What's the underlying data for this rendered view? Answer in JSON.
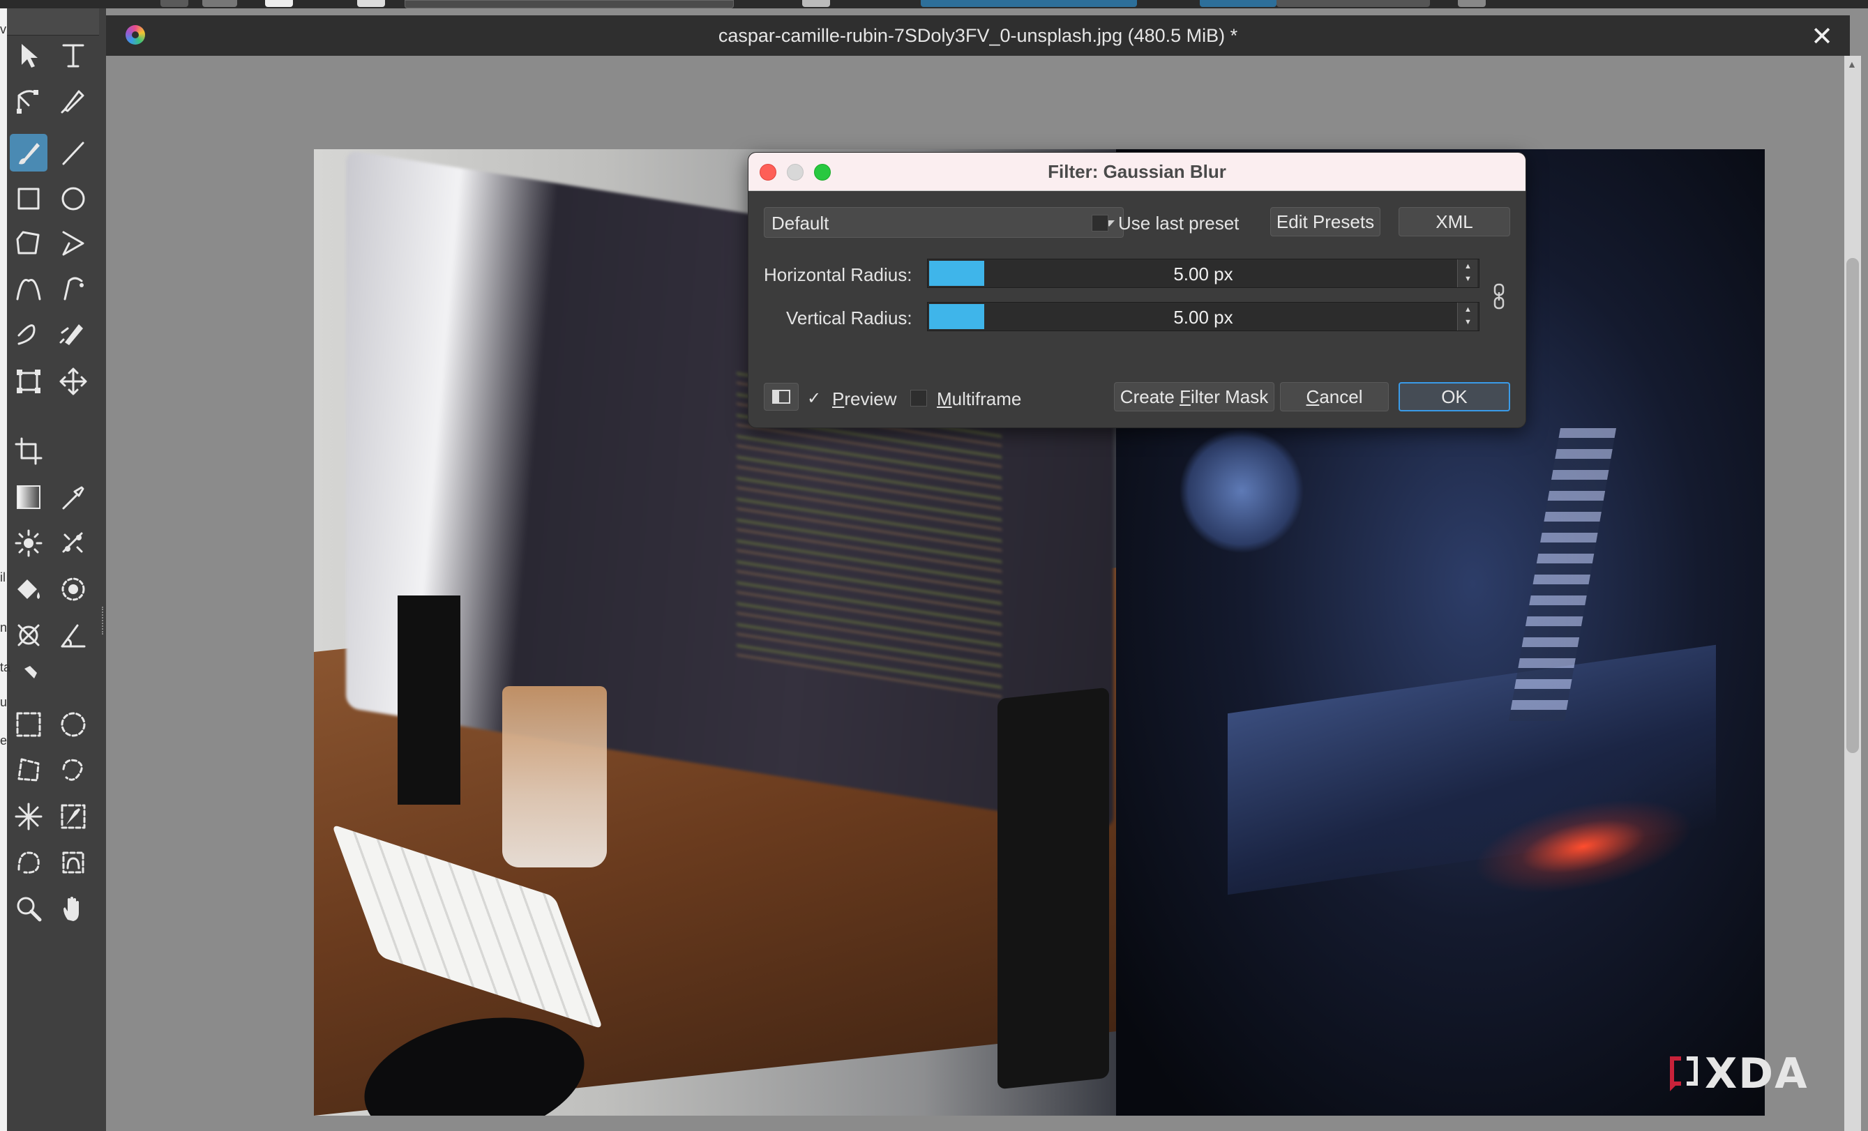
{
  "window": {
    "title": "caspar-camille-rubin-7SDoly3FV_0-unsplash.jpg (480.5 MiB) *",
    "close_glyph": "✕"
  },
  "toolbox": {
    "tools": [
      "select-shapes",
      "text",
      "edit-shapes",
      "calligraphy",
      "freehand-brush",
      "line",
      "rectangle",
      "ellipse",
      "polygon",
      "polyline",
      "bezier-curve",
      "freehand-path",
      "dynamic-brush",
      "multibrush",
      "transform",
      "move",
      "crop",
      "gradient",
      "color-sampler",
      "colorize-mask",
      "smart-patch",
      "fill",
      "enclose-and-fill",
      "assistant",
      "measure",
      "reference-images",
      "rectangular-selection",
      "elliptical-selection",
      "polygonal-selection",
      "freehand-selection",
      "contiguous-selection",
      "similar-color-selection",
      "bezier-selection",
      "magnetic-selection",
      "zoom",
      "pan"
    ],
    "active_tool": "freehand-brush",
    "edge_letters": [
      "v",
      "il",
      "n",
      "ta",
      "u",
      "e"
    ]
  },
  "dialog": {
    "title": "Filter: Gaussian Blur",
    "preset": "Default",
    "use_last_preset_label": "Use last preset",
    "use_last_preset_checked": false,
    "edit_presets_label": "Edit Presets",
    "xml_label": "XML",
    "horizontal_radius_label": "Horizontal Radius:",
    "horizontal_radius_value": "5.00 px",
    "vertical_radius_label": "Vertical Radius:",
    "vertical_radius_value": "5.00 px",
    "slider_fill_fraction": 0.1,
    "preview_label_u": "P",
    "preview_label_rest": "review",
    "preview_checked": true,
    "check_mark": "✓",
    "multiframe_label_u": "M",
    "multiframe_label_rest": "ultiframe",
    "multiframe_checked": false,
    "create_filter_mask_pre": "Create ",
    "create_filter_mask_u": "F",
    "create_filter_mask_post": "ilter Mask",
    "cancel_u": "C",
    "cancel_rest": "ancel",
    "ok_label": "OK"
  },
  "watermark": {
    "text": "XDA"
  },
  "colors": {
    "accent": "#3fb5ea",
    "dialog_bg": "#3c3c3c",
    "titlebar": "#fbeef0",
    "close_red": "#fe5f57",
    "minimize": "#d8d8d8",
    "zoom_green": "#28c840"
  }
}
